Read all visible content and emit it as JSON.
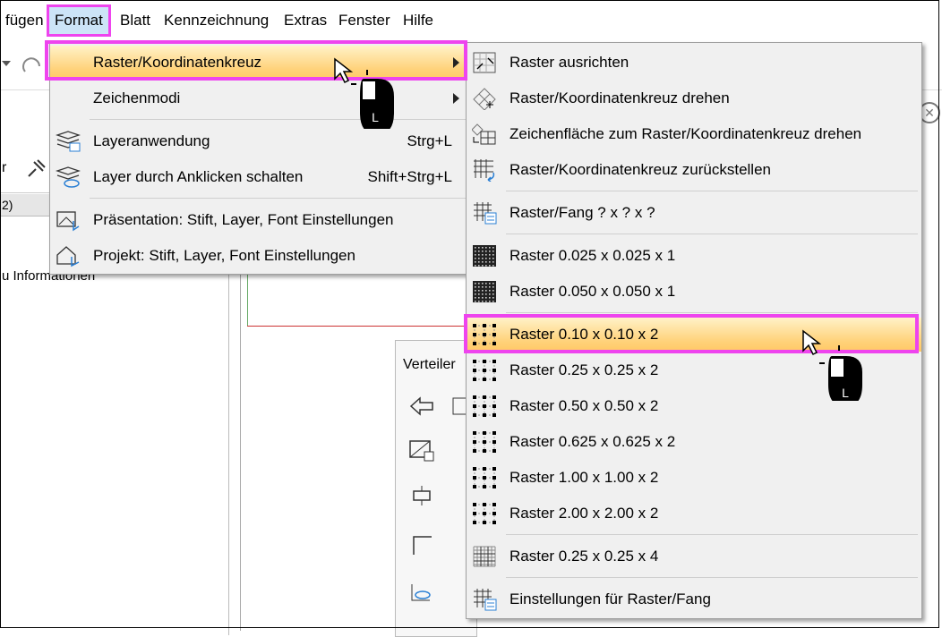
{
  "menubar": {
    "items": [
      "fügen",
      "Format",
      "Blatt",
      "Kennzeichnung",
      "Extras",
      "Fenster",
      "Hilfe"
    ]
  },
  "background": {
    "left_tab": "2)",
    "info_text": "u Informationen",
    "left_strip_text": "r",
    "verteiler_title": "Verteiler"
  },
  "format_menu": {
    "items": [
      {
        "label": "Raster/Koordinatenkreuz",
        "shortcut": "",
        "submenu": true,
        "highlighted": true,
        "icon": "none"
      },
      {
        "label": "Zeichenmodi",
        "shortcut": "",
        "submenu": true,
        "icon": "none"
      },
      {
        "label": "Layeranwendung",
        "shortcut": "Strg+L",
        "icon": "layers-icon"
      },
      {
        "label": "Layer durch Anklicken schalten",
        "shortcut": "Shift+Strg+L",
        "icon": "layers-eye-icon"
      },
      {
        "label": "Präsentation: Stift, Layer, Font Einstellungen",
        "shortcut": "",
        "icon": "presentation-icon"
      },
      {
        "label": "Projekt: Stift, Layer, Font Einstellungen",
        "shortcut": "",
        "icon": "project-icon"
      }
    ]
  },
  "raster_submenu": {
    "items": [
      {
        "label": "Raster ausrichten",
        "icon": "grid-align-icon"
      },
      {
        "label": "Raster/Koordinatenkreuz drehen",
        "icon": "grid-rotate-icon"
      },
      {
        "label": "Zeichenfläche zum Raster/Koordinatenkreuz drehen",
        "icon": "canvas-rotate-icon"
      },
      {
        "label": "Raster/Koordinatenkreuz zurückstellen",
        "icon": "grid-reset-icon"
      },
      {
        "label": "Raster/Fang ? x ? x ?",
        "icon": "grid-settings-icon"
      },
      {
        "label": "Raster 0.025 x 0.025 x 1",
        "icon": "dense-grid-icon"
      },
      {
        "label": "Raster 0.050 x 0.050 x 1",
        "icon": "dense-grid-icon"
      },
      {
        "label": "Raster 0.10 x 0.10 x 2",
        "icon": "dot-grid-icon",
        "highlighted": true
      },
      {
        "label": "Raster 0.25 x 0.25 x 2",
        "icon": "dot-grid-icon"
      },
      {
        "label": "Raster 0.50 x 0.50 x 2",
        "icon": "dot-grid-icon"
      },
      {
        "label": "Raster 0.625 x 0.625 x 2",
        "icon": "dot-grid-icon"
      },
      {
        "label": "Raster 1.00 x 1.00 x 2",
        "icon": "dot-grid-icon"
      },
      {
        "label": "Raster 2.00 x 2.00 x 2",
        "icon": "dot-grid-icon"
      },
      {
        "label": "Raster 0.25 x 0.25 x 4",
        "icon": "fine-grid-icon"
      },
      {
        "label": "Einstellungen für Raster/Fang",
        "icon": "grid-settings-icon"
      }
    ]
  },
  "cursor_label": "L",
  "colors": {
    "highlight_outline": "#ee44ee",
    "menu_hover": "#ffd27a",
    "menubar_active": "#cce4f7"
  }
}
